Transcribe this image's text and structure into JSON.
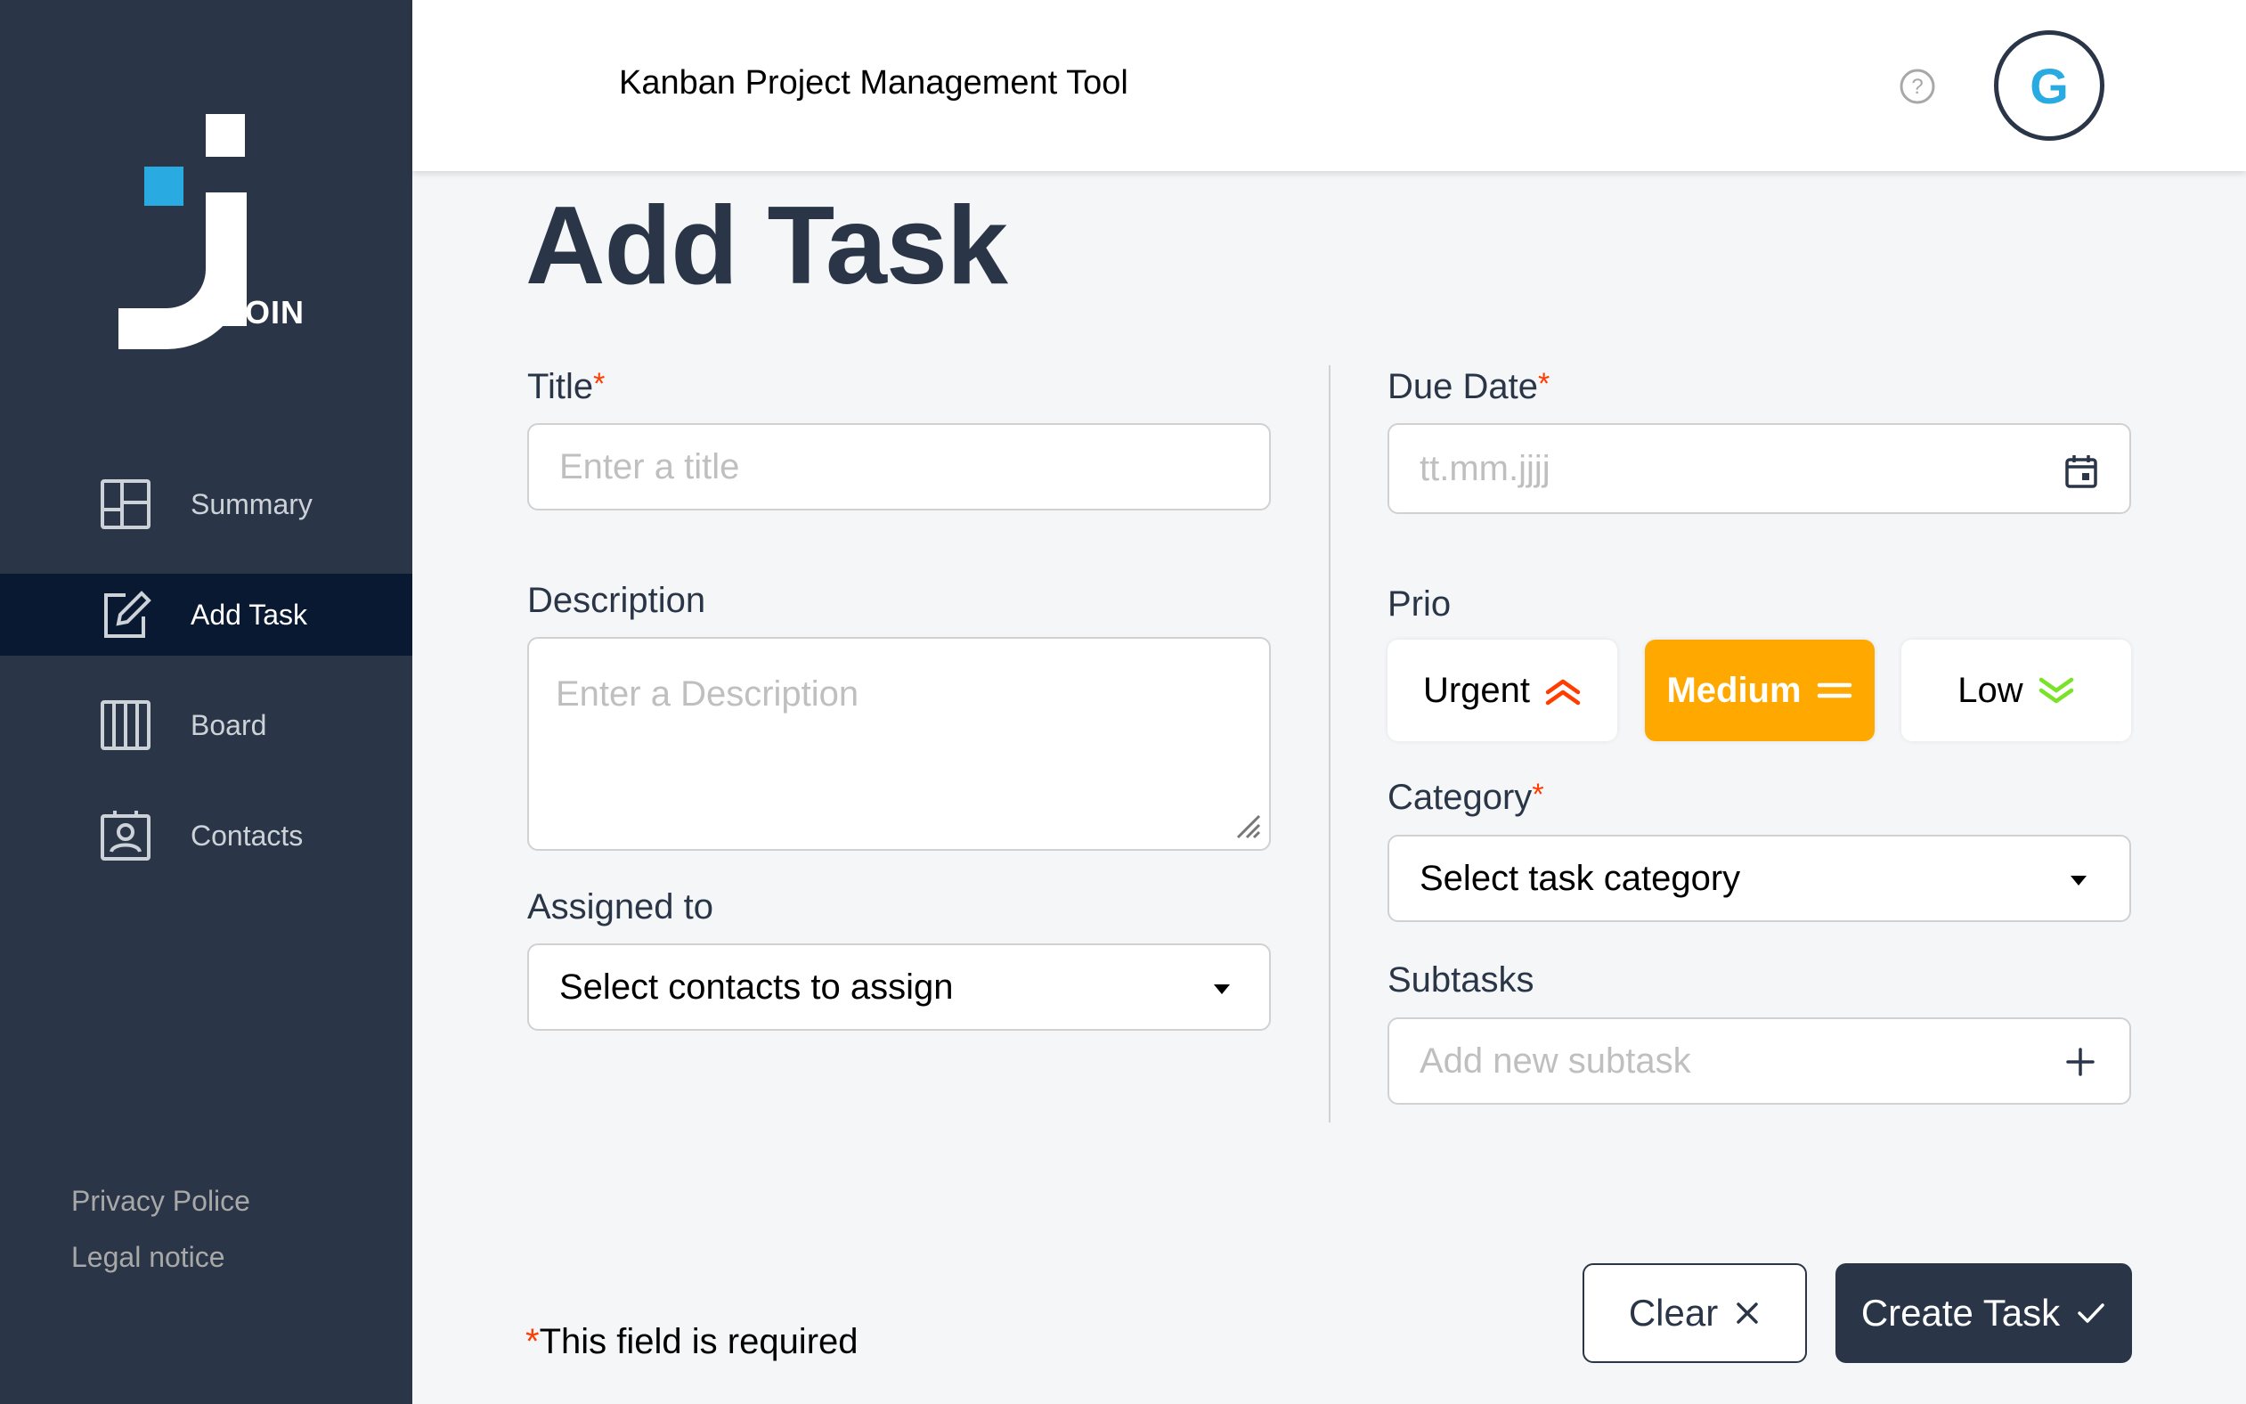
{
  "sidebar": {
    "logo_text": "OIN",
    "items": [
      {
        "label": "Summary",
        "icon": "summary-icon"
      },
      {
        "label": "Add Task",
        "icon": "add-task-icon",
        "active": true
      },
      {
        "label": "Board",
        "icon": "board-icon"
      },
      {
        "label": "Contacts",
        "icon": "contacts-icon"
      }
    ],
    "footer_links": [
      "Privacy Police",
      "Legal notice"
    ]
  },
  "header": {
    "title": "Kanban Project Management Tool",
    "help_icon": "help-icon",
    "avatar_initial": "G"
  },
  "main": {
    "page_title": "Add Task",
    "title_field": {
      "label": "Title",
      "required_mark": "*",
      "placeholder": "Enter a title"
    },
    "description_field": {
      "label": "Description",
      "placeholder": "Enter a Description"
    },
    "assigned_field": {
      "label": "Assigned to",
      "value": "Select contacts to assign"
    },
    "due_date_field": {
      "label": "Due Date",
      "required_mark": "*",
      "placeholder": "tt.mm.jjjj"
    },
    "prio": {
      "label": "Prio",
      "options": [
        "Urgent",
        "Medium",
        "Low"
      ],
      "selected": "Medium"
    },
    "category_field": {
      "label": "Category",
      "required_mark": "*",
      "value": "Select task category"
    },
    "subtasks_field": {
      "label": "Subtasks",
      "placeholder": "Add new subtask"
    },
    "required_note": {
      "mark": "*",
      "text": "This field is required"
    },
    "buttons": {
      "clear": "Clear",
      "create": "Create Task"
    }
  },
  "colors": {
    "sidebar_bg": "#2a3647",
    "active_nav_bg": "#091931",
    "accent_blue": "#29abe2",
    "urgent": "#ff3d00",
    "medium": "#ffa800",
    "low": "#7ae229"
  }
}
